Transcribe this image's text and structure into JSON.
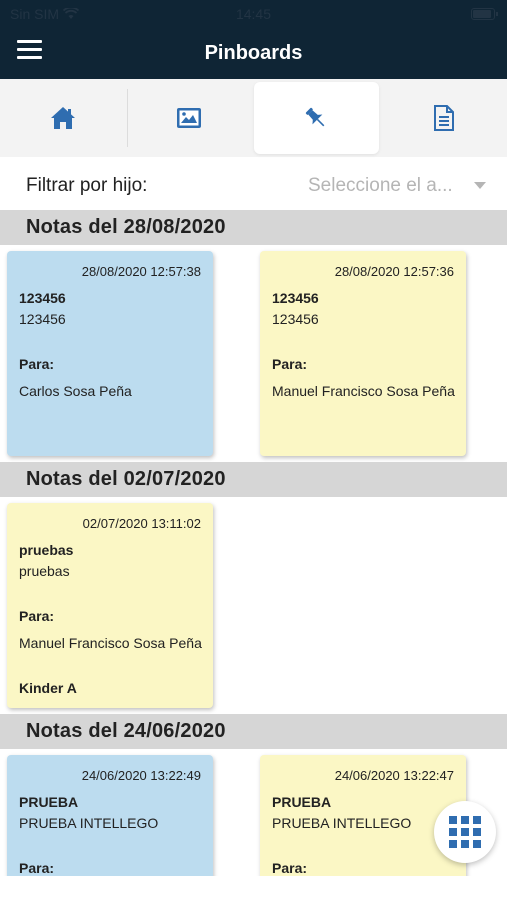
{
  "status": {
    "carrier": "Sin SIM",
    "time": "14:45"
  },
  "header": {
    "title": "Pinboards"
  },
  "tabs": [
    {
      "icon": "home-icon",
      "active": false
    },
    {
      "icon": "image-icon",
      "active": false
    },
    {
      "icon": "pin-icon",
      "active": true
    },
    {
      "icon": "document-icon",
      "active": false
    }
  ],
  "filter": {
    "label": "Filtrar por hijo:",
    "placeholder": "Seleccione el a..."
  },
  "colors": {
    "navbar": "#0f2535",
    "accent": "#2f6db0",
    "note_blue": "#bcdcef",
    "note_yellow": "#fbf7c5",
    "section": "#d6d6d6"
  },
  "sections": [
    {
      "title": "Notas del 28/08/2020",
      "notes": [
        {
          "color": "blue",
          "date": "28/08/2020 12:57:38",
          "subject": "123456",
          "body": "123456",
          "para_label": "Para:",
          "to": "Carlos Sosa Peña",
          "group": ""
        },
        {
          "color": "yellow",
          "date": "28/08/2020 12:57:36",
          "subject": "123456",
          "body": "123456",
          "para_label": "Para:",
          "to": "Manuel Francisco Sosa Peña",
          "group": ""
        }
      ]
    },
    {
      "title": "Notas del 02/07/2020",
      "notes": [
        {
          "color": "yellow",
          "date": "02/07/2020 13:11:02",
          "subject": "pruebas",
          "body": "pruebas",
          "para_label": "Para:",
          "to": "Manuel Francisco Sosa Peña",
          "group": "Kinder A"
        }
      ]
    },
    {
      "title": "Notas del 24/06/2020",
      "notes": [
        {
          "color": "blue",
          "date": "24/06/2020 13:22:49",
          "subject": "PRUEBA",
          "body": "PRUEBA INTELLEGO",
          "para_label": "Para:",
          "to": "",
          "group": ""
        },
        {
          "color": "yellow",
          "date": "24/06/2020 13:22:47",
          "subject": "PRUEBA",
          "body": "PRUEBA INTELLEGO",
          "para_label": "Para:",
          "to": "",
          "group": ""
        }
      ]
    }
  ],
  "fab": {
    "icon": "apps-grid-icon"
  }
}
